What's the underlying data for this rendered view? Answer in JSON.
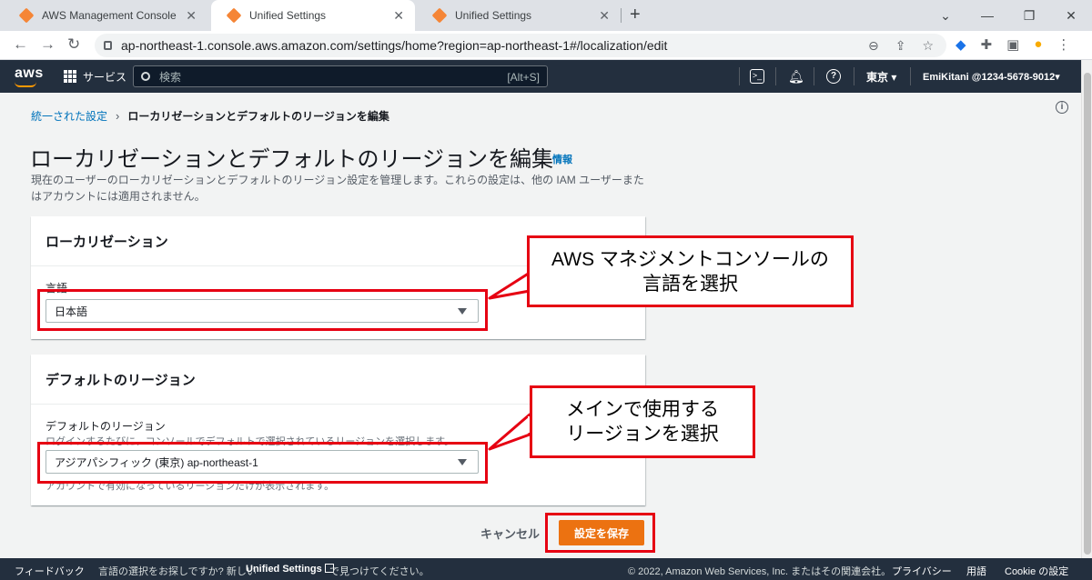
{
  "browser": {
    "tabs": [
      {
        "title": "AWS Management Console",
        "active": false
      },
      {
        "title": "Unified Settings",
        "active": true
      },
      {
        "title": "Unified Settings",
        "active": false
      }
    ],
    "url": "ap-northeast-1.console.aws.amazon.com/settings/home?region=ap-northeast-1#/localization/edit"
  },
  "aws_nav": {
    "services_label": "サービス",
    "search_placeholder": "検索",
    "search_shortcut": "[Alt+S]",
    "region": "東京 ▾",
    "account": "EmiKitani @1234-5678-9012▾"
  },
  "breadcrumb": {
    "root": "統一された設定",
    "current": "ローカリゼーションとデフォルトのリージョンを編集"
  },
  "page": {
    "title": "ローカリゼーションとデフォルトのリージョンを編集",
    "info_link": "情報",
    "description": "現在のユーザーのローカリゼーションとデフォルトのリージョン設定を管理します。これらの設定は、他の IAM ユーザーまたはアカウントには適用されません。"
  },
  "localization": {
    "heading": "ローカリゼーション",
    "language_label": "言語",
    "language_value": "日本語"
  },
  "default_region": {
    "heading": "デフォルトのリージョン",
    "label": "デフォルトのリージョン",
    "description": "ログインするたびに、コンソールでデフォルトで選択されているリージョンを選択します。",
    "value": "アジアパシフィック (東京) ap-northeast-1",
    "constraint": "アカウントで有効になっているリージョンだけが表示されます。"
  },
  "annotations": {
    "callout_language": "AWS マネジメントコンソールの\n言語を選択",
    "callout_region": "メインで使用する\nリージョンを選択"
  },
  "actions": {
    "cancel": "キャンセル",
    "save": "設定を保存"
  },
  "footer": {
    "feedback": "フィードバック",
    "language_prompt": "言語の選択をお探しですか? 新しい",
    "unified_settings": "Unified Settings",
    "find_it": "で見つけてください。",
    "copyright": "© 2022, Amazon Web Services, Inc. またはその関連会社。",
    "privacy": "プライバシー",
    "terms": "用語",
    "cookie": "Cookie の設定"
  },
  "colors": {
    "aws_nav": "#232f3e",
    "primary_button": "#ec7211",
    "link": "#0073bb",
    "annotation": "#e60012"
  }
}
